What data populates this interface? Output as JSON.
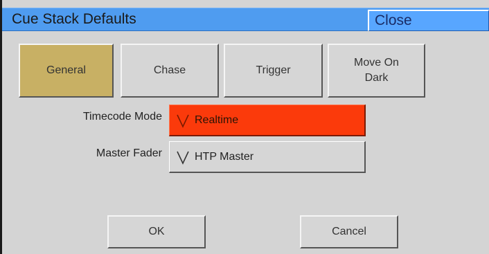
{
  "window": {
    "title": "Cue Stack Defaults",
    "close_label": "Close"
  },
  "tabs": [
    {
      "label": "General",
      "active": true
    },
    {
      "label": "Chase",
      "active": false
    },
    {
      "label": "Trigger",
      "active": false
    },
    {
      "label": "Move On\nDark",
      "active": false
    }
  ],
  "fields": {
    "timecode_mode": {
      "label": "Timecode Mode",
      "value": "Realtime",
      "icon": "chevron-down-icon"
    },
    "master_fader": {
      "label": "Master Fader",
      "value": "HTP Master",
      "icon": "chevron-down-icon"
    }
  },
  "buttons": {
    "ok_label": "OK",
    "cancel_label": "Cancel"
  },
  "colors": {
    "titlebar": "#4f9cf0",
    "active_tab": "#c8b064",
    "highlight_field": "#fb3a0b",
    "panel": "#d4d4d4"
  }
}
